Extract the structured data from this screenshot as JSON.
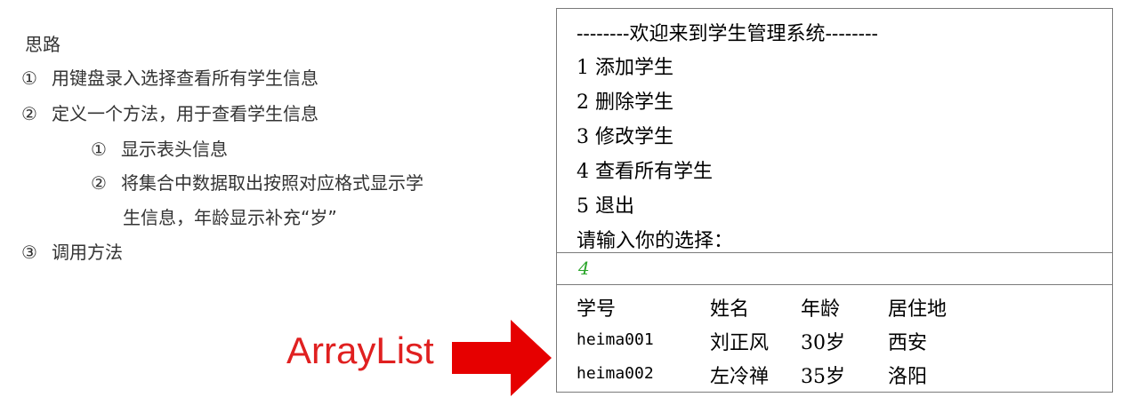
{
  "outline": {
    "heading": "思路",
    "steps": [
      {
        "num": "①",
        "text": "用键盘录入选择查看所有学生信息"
      },
      {
        "num": "②",
        "text": "定义一个方法，用于查看学生信息"
      },
      {
        "num": "①",
        "text": "显示表头信息"
      },
      {
        "num": "②",
        "text": "将集合中数据取出按照对应格式显示学"
      },
      {
        "num": "",
        "text": "生信息，年龄显示补充“岁”"
      },
      {
        "num": "③",
        "text": "调用方法"
      }
    ]
  },
  "console": {
    "banner": "--------欢迎来到学生管理系统--------",
    "menu": [
      "1 添加学生",
      "2 删除学生",
      "3 修改学生",
      "4 查看所有学生",
      "5 退出"
    ],
    "prompt": "请输入你的选择：",
    "input_value": "4",
    "table": {
      "headers": [
        "学号",
        "姓名",
        "年龄",
        "居住地"
      ],
      "rows": [
        [
          "heima001",
          "刘正风",
          "30岁",
          "西安"
        ],
        [
          "heima002",
          "左冷禅",
          "35岁",
          "洛阳"
        ]
      ]
    }
  },
  "annotation": {
    "label": "ArrayList",
    "color": "#e02020"
  }
}
